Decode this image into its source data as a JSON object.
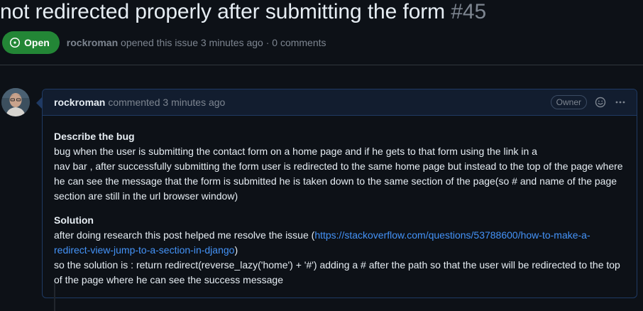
{
  "issue": {
    "title": "not redirected properly after submitting the form",
    "number": "#45",
    "state_label": "Open",
    "meta_author": "rockroman",
    "meta_text": "opened this issue 3 minutes ago · 0 comments"
  },
  "comment": {
    "author": "rockroman",
    "action": "commented 3 minutes ago",
    "role_badge": "Owner",
    "sections": {
      "bug_heading": "Describe the bug",
      "bug_line1": "bug when the user is submitting the contact form on a home page and if he gets to that form using the link in a",
      "bug_line2": "nav bar , after successfully submitting the form user is redirected to the same home page but instead to the top of the page where he can see the message that the form is submitted he is taken down to the same section of the page(so # and name of the page section are still in the url browser window)",
      "solution_heading": "Solution",
      "solution_text_before": "after doing research this post helped me resolve the issue (",
      "solution_link": "https://stackoverflow.com/questions/53788600/how-to-make-a-redirect-view-jump-to-a-section-in-django",
      "solution_text_after": ")",
      "solution_line2": "so the solution is : return redirect(reverse_lazy('home') + '#') adding a # after the path so that the user will be redirected to the top of the page where he can see the success message"
    }
  },
  "icons": {
    "state": "issue-opened-icon",
    "reaction": "smiley-icon",
    "more": "kebab-horizontal-icon"
  },
  "colors": {
    "open_green": "#238636",
    "link_blue": "#4493f8",
    "highlight_border": "#1f3a64"
  }
}
